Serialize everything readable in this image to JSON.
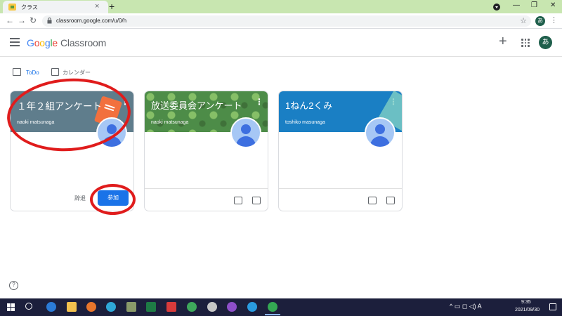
{
  "browser": {
    "tab_title": "クラス",
    "tab_close": "×",
    "new_tab": "+",
    "url": "classroom.google.com/u/0/h",
    "account_initial": "あ",
    "nav_back": "←",
    "nav_forward": "→",
    "nav_reload": "↻",
    "star": "☆",
    "menu": "⋮",
    "win_min": "—",
    "win_max": "❐",
    "win_close": "✕"
  },
  "header": {
    "logo_g": [
      "G",
      "o",
      "o",
      "g",
      "l",
      "e"
    ],
    "app_name": "Classroom",
    "plus": "+",
    "account_initial": "あ"
  },
  "subnav": {
    "todo": "ToDo",
    "calendar": "カレンダー"
  },
  "cards": [
    {
      "title": "１年２組アンケート",
      "owner": "naoki matsunaga",
      "decline_label": "辞退",
      "join_label": "参加",
      "banner_color": "#5f7d8c"
    },
    {
      "title": "放送委員会アンケート",
      "owner": "naoki matsunaga",
      "banner_color": "#4d8c48"
    },
    {
      "title": "1ねん2くみ",
      "owner": "toshiko masunaga",
      "banner_color": "#1a7fc4"
    }
  ],
  "kebab": "⋮",
  "help": "?",
  "taskbar": {
    "time": "9:35",
    "date": "2021/09/30",
    "tray_text": "^ ▭ ◻ ◁) A"
  },
  "colors": {
    "accent": "#1a73e8",
    "annotation": "#e01c1c",
    "taskbar": "#1c1f3c",
    "tabstrip": "#c8e6b0"
  }
}
